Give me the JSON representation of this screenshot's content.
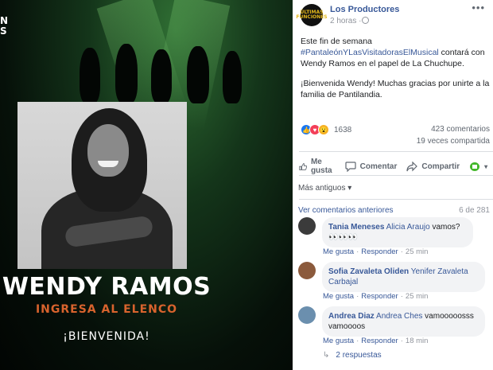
{
  "photo": {
    "corner_logo_lines": [
      "N",
      "S"
    ],
    "headline": "WENDY RAMOS",
    "subheadline": "INGRESA AL ELENCO",
    "welcome": "¡BIENVENIDA!"
  },
  "post": {
    "page_name": "Los Productores",
    "page_avatar_text": "ÚLTIMAS FUNCIONES",
    "time": "2 horas",
    "text_parts": {
      "intro": "Este fin de semana ",
      "hashtag": "#PantaleónYLasVisitadorasElMusical",
      "rest": " contará con Wendy Ramos en el papel de La Chuchupe."
    },
    "text_paragraph_2": "¡Bienvenida Wendy! Muchas gracias por unirte a la familia de Pantilandia.",
    "reaction_count": "1638",
    "comment_count": "423 comentarios",
    "share_count": "19 veces compartida",
    "actions": {
      "like": "Me gusta",
      "comment": "Comentar",
      "share": "Compartir"
    },
    "sort_label": "Más antiguos ▾",
    "previous_comments": "Ver comentarios anteriores",
    "pager": "6 de 281",
    "comments": [
      {
        "author": "Tania Meneses",
        "mention": "Alicia Araujo",
        "text": " vamos? 👀👀👀",
        "like": "Me gusta",
        "reply": "Responder",
        "time": "25 min",
        "avatar_color": "#3b3b3b"
      },
      {
        "author": "Sofia Zavaleta Oliden",
        "mention": "Yenifer Zavaleta Carbajal",
        "text": "",
        "like": "Me gusta",
        "reply": "Responder",
        "time": "25 min",
        "avatar_color": "#8b5a3c"
      },
      {
        "author": "Andrea Diaz",
        "mention": "Andrea Ches",
        "text": " vamooooosss vamoooos",
        "like": "Me gusta",
        "reply": "Responder",
        "time": "18 min",
        "avatar_color": "#6b8fae"
      }
    ],
    "replies_label": "2 respuestas"
  },
  "colors": {
    "link": "#385898",
    "muted": "#90949c",
    "accent_orange": "#d8632d",
    "like_blue": "#1877f2"
  }
}
